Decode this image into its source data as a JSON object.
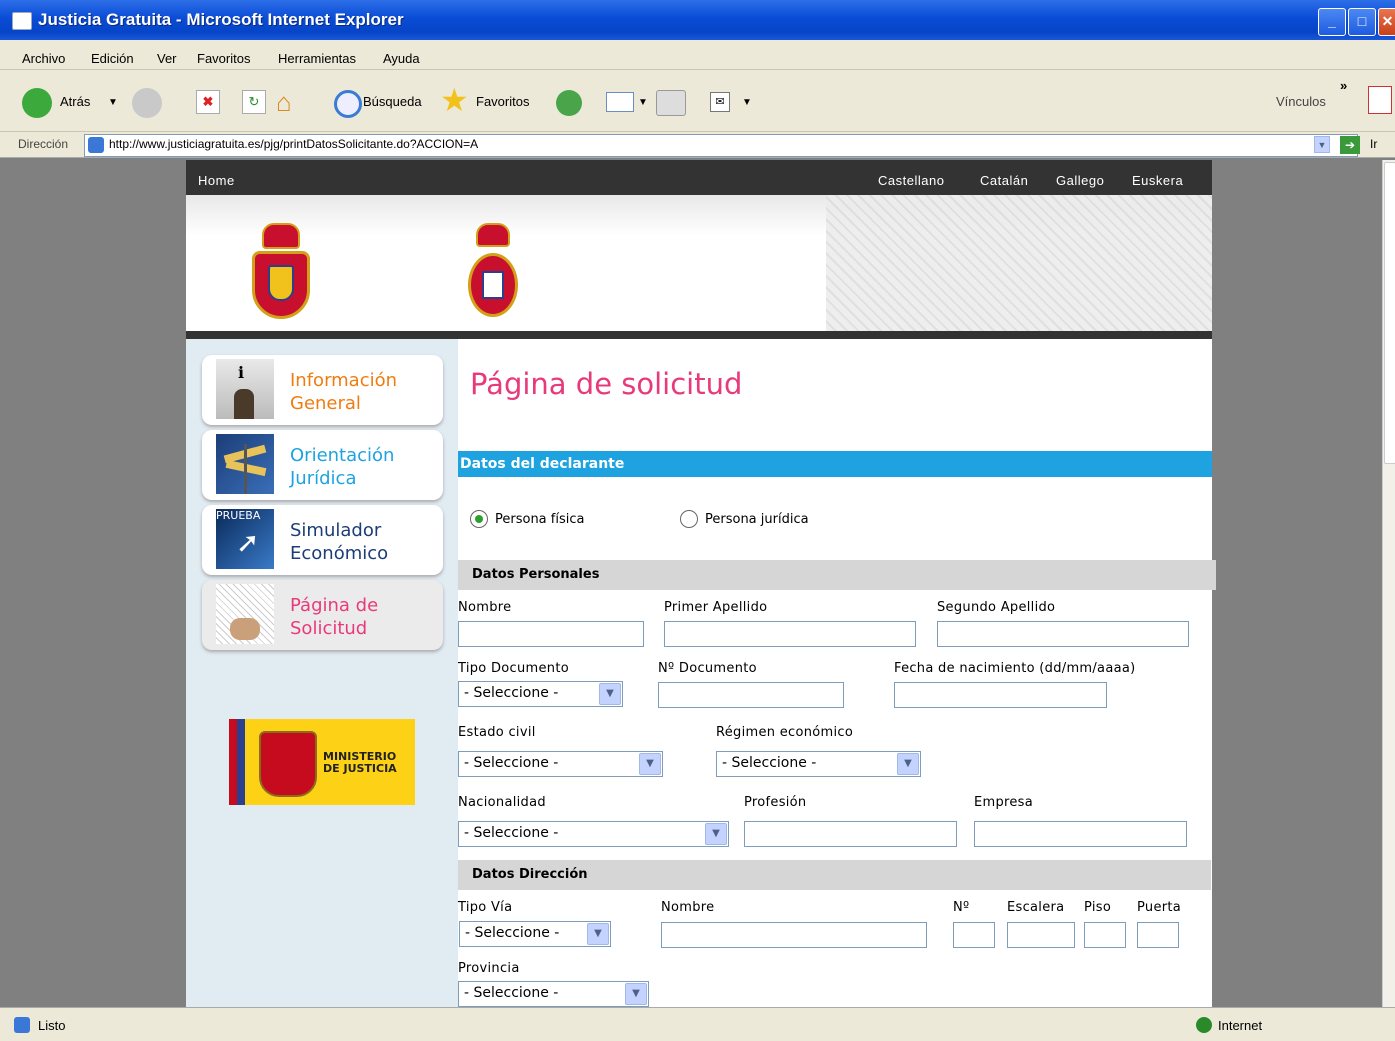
{
  "window": {
    "title": "Justicia Gratuita - Microsoft Internet Explorer"
  },
  "menu": [
    "Archivo",
    "Edición",
    "Ver",
    "Favoritos",
    "Herramientas",
    "Ayuda"
  ],
  "toolbar": {
    "back": "Atrás",
    "search": "Búsqueda",
    "favorites": "Favoritos",
    "links": "Vínculos"
  },
  "address": {
    "label": "Dirección",
    "url": "http://www.justiciagratuita.es/pjg/printDatosSolicitante.do?ACCION=A",
    "go": "Ir"
  },
  "status": {
    "text": "Listo",
    "zone": "Internet"
  },
  "nav": {
    "home": "Home",
    "languages": [
      "Castellano",
      "Catalán",
      "Gallego",
      "Euskera"
    ]
  },
  "sidebar": {
    "items": [
      {
        "line1": "Información",
        "line2": "General"
      },
      {
        "line1": "Orientación",
        "line2": "Jurídica"
      },
      {
        "line1": "Simulador",
        "line2": "Económico",
        "badge": "PRUEBA"
      },
      {
        "line1": "Página de",
        "line2": "Solicitud"
      }
    ],
    "ministry": {
      "line1": "MINISTERIO",
      "line2": "DE JUSTICIA"
    }
  },
  "form": {
    "title": "Página de solicitud",
    "section": "Datos del declarante",
    "radios": [
      {
        "label": "Persona física",
        "checked": true
      },
      {
        "label": "Persona jurídica",
        "checked": false
      }
    ],
    "personal": {
      "header": "Datos Personales",
      "nombre": "Nombre",
      "apellido1": "Primer Apellido",
      "apellido2": "Segundo Apellido",
      "tipo_doc": "Tipo Documento",
      "num_doc": "Nº Documento",
      "fecha_nac": "Fecha de nacimiento (dd/mm/aaaa)",
      "estado_civil": "Estado civil",
      "regimen": "Régimen económico",
      "nacionalidad": "Nacionalidad",
      "profesion": "Profesión",
      "empresa": "Empresa",
      "select_default": "- Seleccione -"
    },
    "direccion": {
      "header": "Datos Dirección",
      "tipo_via": "Tipo Vía",
      "nombre": "Nombre",
      "numero": "Nº",
      "escalera": "Escalera",
      "piso": "Piso",
      "puerta": "Puerta",
      "provincia": "Provincia"
    }
  }
}
